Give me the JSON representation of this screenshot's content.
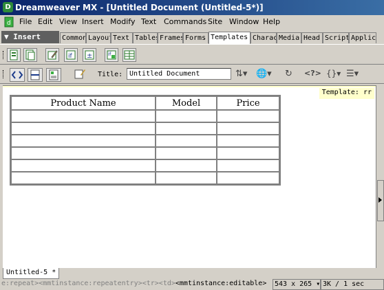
{
  "window": {
    "title": "Dreamweaver MX - [Untitled Document (Untitled-5*)]"
  },
  "menubar": {
    "items": [
      "File",
      "Edit",
      "View",
      "Insert",
      "Modify",
      "Text",
      "Commands",
      "Site",
      "Window",
      "Help"
    ]
  },
  "insert_bar": {
    "label": "Insert",
    "tabs": [
      "Common",
      "Layout",
      "Text",
      "Tables",
      "Frames",
      "Forms",
      "Templates",
      "Characters",
      "Media",
      "Head",
      "Script",
      "Application"
    ],
    "active_tab": "Templates",
    "buttons": [
      "make-template-icon",
      "make-nested-template-icon",
      "editable-region-icon",
      "optional-region-icon",
      "repeating-region-icon",
      "editable-optional-region-icon",
      "repeating-table-icon"
    ]
  },
  "document_toolbar": {
    "title_label": "Title:",
    "title_value": "Untitled Document"
  },
  "canvas": {
    "template_label": "Template: rr",
    "table": {
      "headers": [
        "Product Name",
        "Model",
        "Price"
      ],
      "rows": [
        [
          "",
          "",
          ""
        ],
        [
          "",
          "",
          ""
        ],
        [
          "",
          "",
          ""
        ],
        [
          "",
          "",
          ""
        ],
        [
          "",
          "",
          ""
        ],
        [
          "",
          "",
          ""
        ]
      ]
    }
  },
  "document_tabs": [
    "Untitled-5 *"
  ],
  "statusbar": {
    "tags": [
      "e:repeat>",
      "<mmtinstance:repeatentry>",
      "<tr>",
      "<td>"
    ],
    "active_tag": "<mmtinstance:editable>",
    "window_size": "543 x 265",
    "download": "3K / 1 sec"
  }
}
